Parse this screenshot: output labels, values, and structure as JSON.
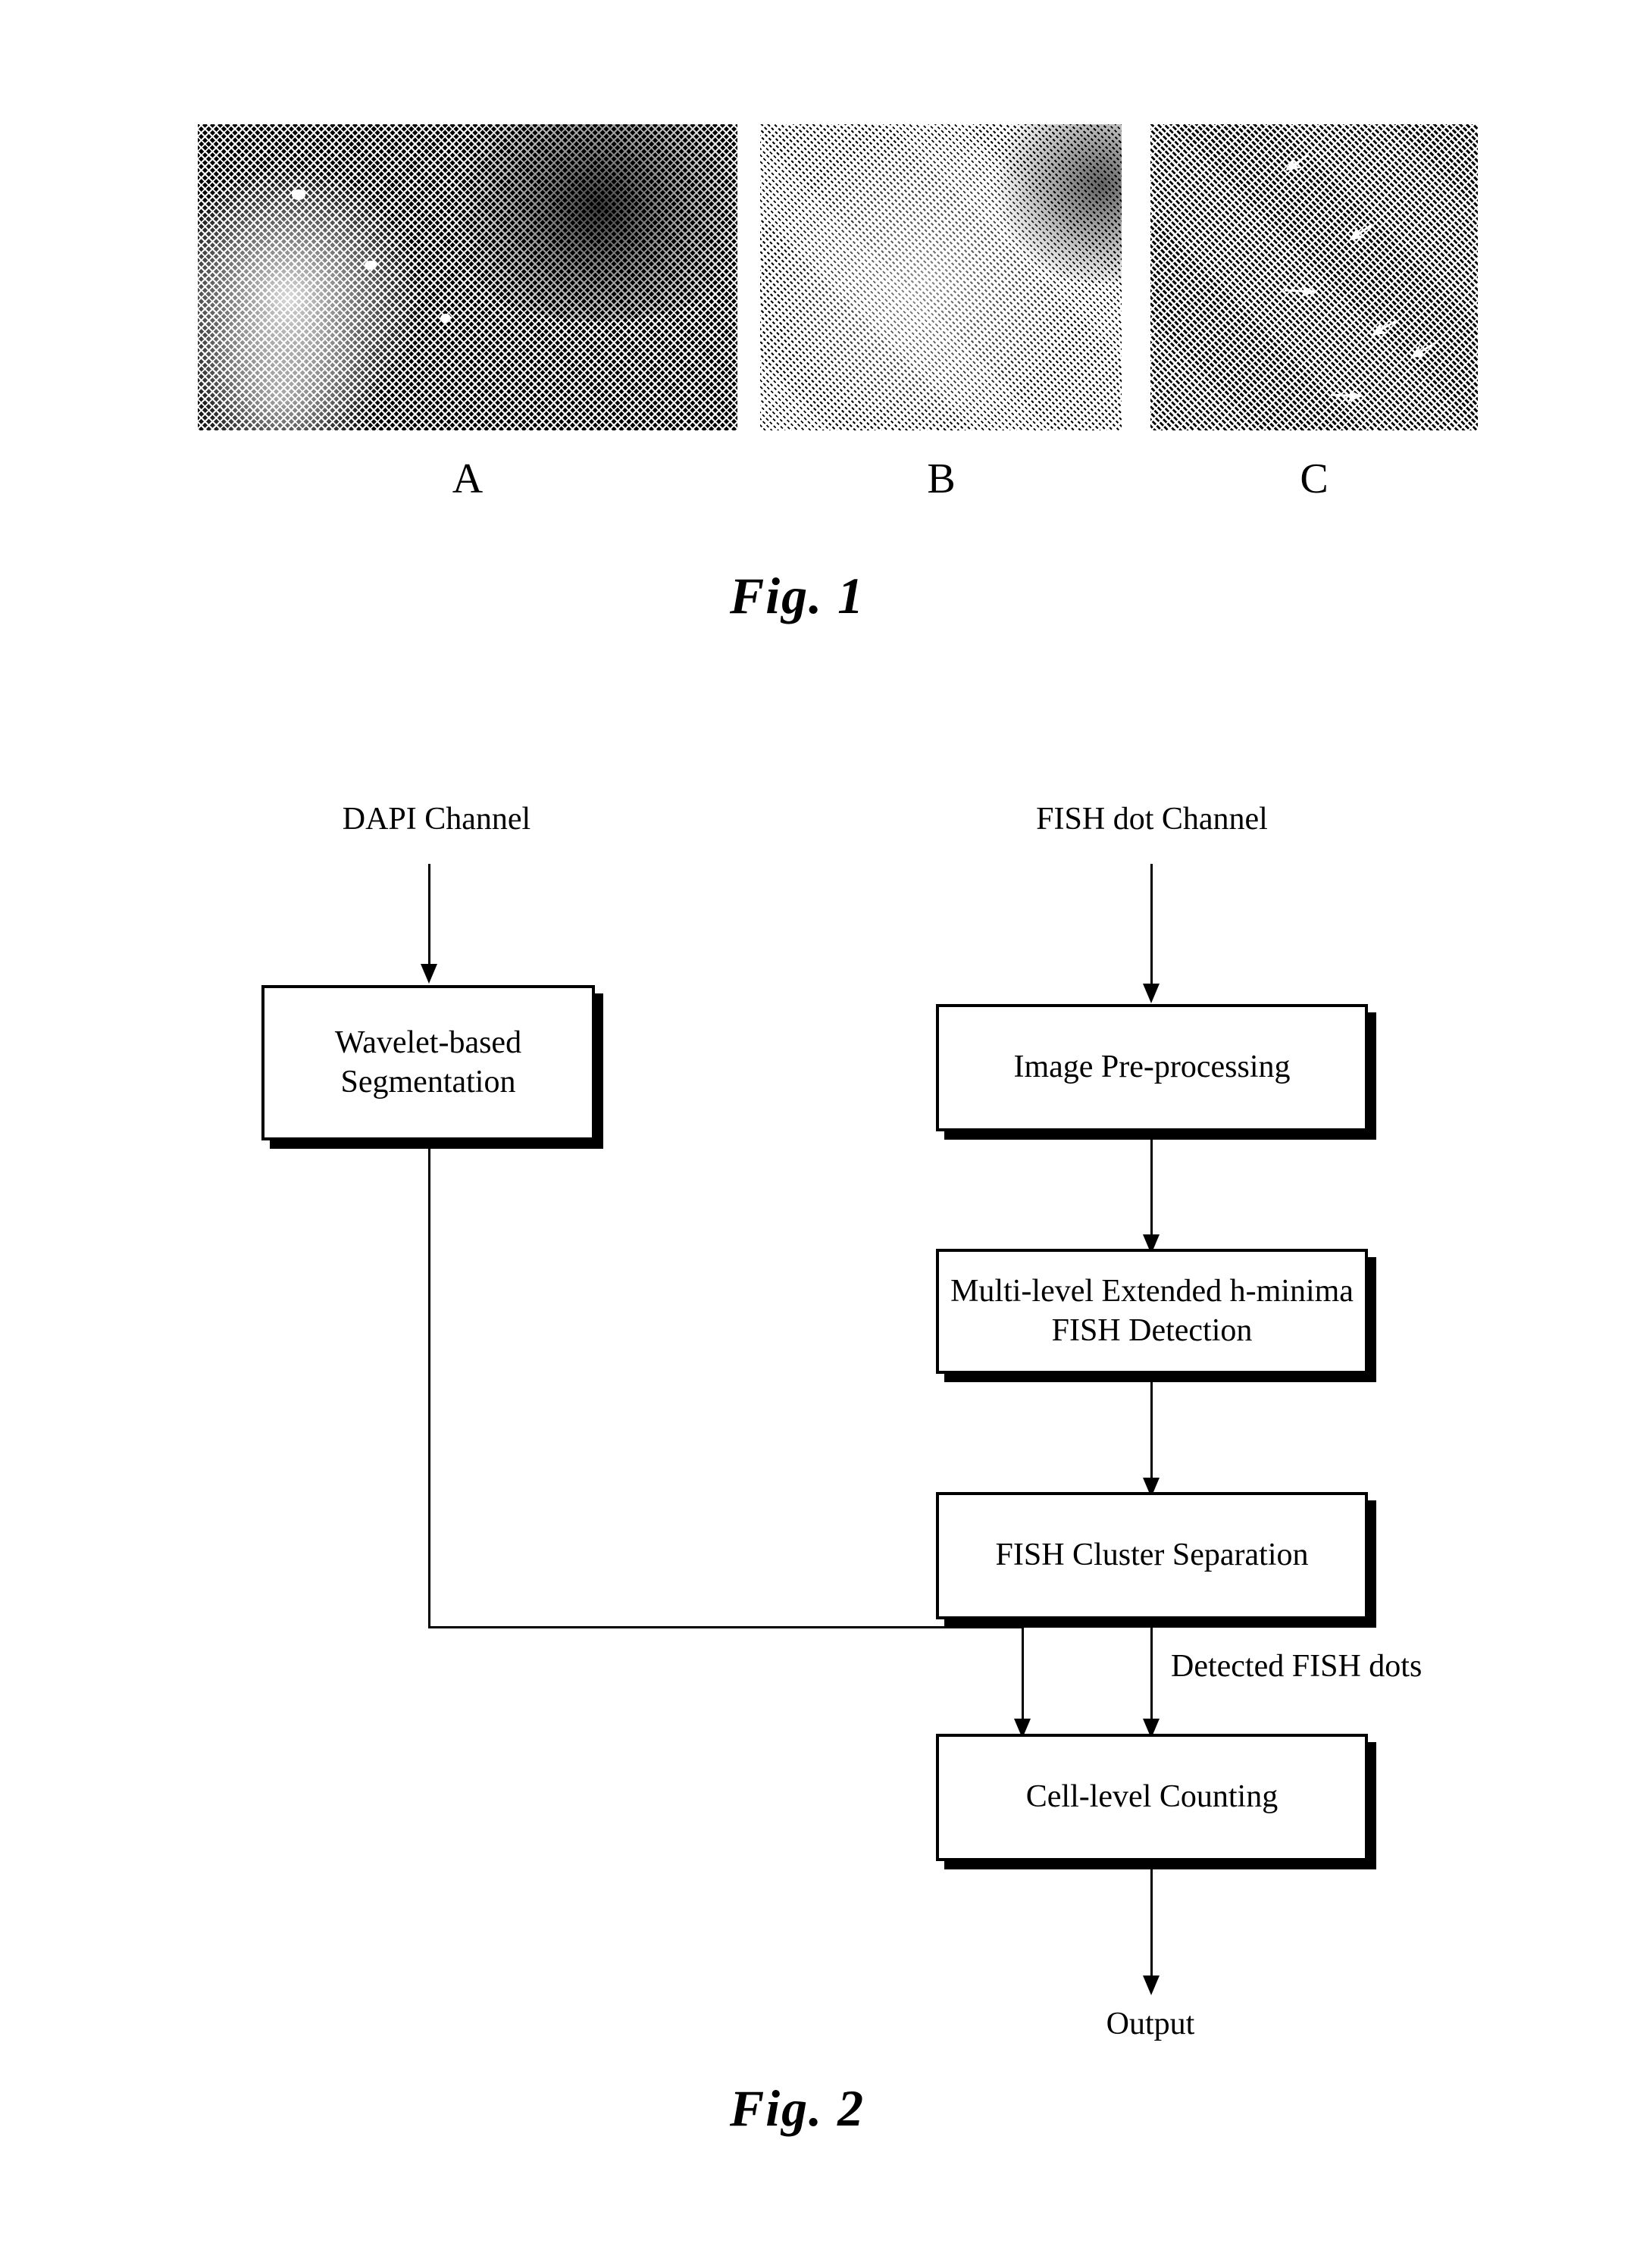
{
  "figure1": {
    "caption": "Fig. 1",
    "panels": [
      {
        "id": "A",
        "label": "A",
        "tone": "dark",
        "description": "DAPI channel microscopy image"
      },
      {
        "id": "B",
        "label": "B",
        "tone": "light",
        "description": "FISH dot channel microscopy image"
      },
      {
        "id": "C",
        "label": "C",
        "tone": "mid",
        "description": "Detected FISH dots marked with arrows"
      }
    ],
    "panel_c_arrow_count": 6
  },
  "figure2": {
    "caption": "Fig. 2",
    "inputs": {
      "left": "DAPI Channel",
      "right": "FISH dot Channel"
    },
    "boxes": {
      "wavelet": "Wavelet-based Segmentation",
      "preprocessing": "Image Pre-processing",
      "detection": "Multi-level Extended h-minima FISH Detection",
      "cluster": "FISH Cluster Separation",
      "counting": "Cell-level Counting"
    },
    "edge_labels": {
      "detected_dots": "Detected FISH dots"
    },
    "output": "Output"
  },
  "colors": {
    "ink": "#000000",
    "paper": "#ffffff"
  }
}
